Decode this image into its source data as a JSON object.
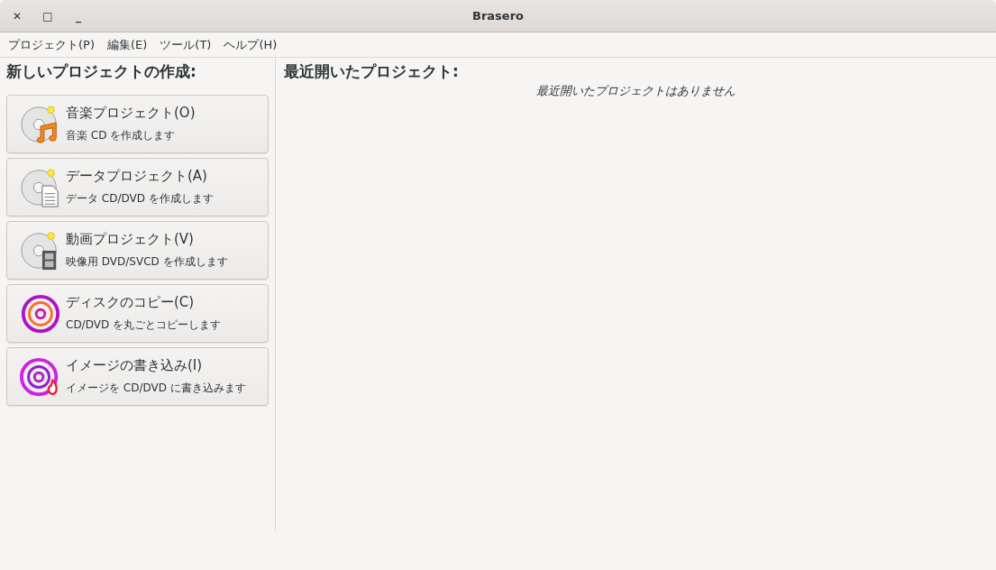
{
  "window": {
    "title": "Brasero"
  },
  "window_buttons": [
    "✕",
    "□",
    "_"
  ],
  "menu": [
    "プロジェクト(P)",
    "編集(E)",
    "ツール(T)",
    "ヘルプ(H)"
  ],
  "new_project": {
    "heading": "新しいプロジェクトの作成:",
    "buttons": [
      {
        "kind": "audio",
        "title": "音楽プロジェクト(O)",
        "subtitle": "音楽 CD を作成します"
      },
      {
        "kind": "data",
        "title": "データプロジェクト(A)",
        "subtitle": "データ CD/DVD を作成します"
      },
      {
        "kind": "video",
        "title": "動画プロジェクト(V)",
        "subtitle": "映像用 DVD/SVCD を作成します"
      },
      {
        "kind": "copy",
        "title": "ディスクのコピー(C)",
        "subtitle": "CD/DVD を丸ごとコピーします"
      },
      {
        "kind": "burn",
        "title": "イメージの書き込み(I)",
        "subtitle": "イメージを CD/DVD に書き込みます"
      }
    ]
  },
  "recent": {
    "heading": "最近開いたプロジェクト:",
    "empty_message": "最近開いたプロジェクトはありません"
  }
}
